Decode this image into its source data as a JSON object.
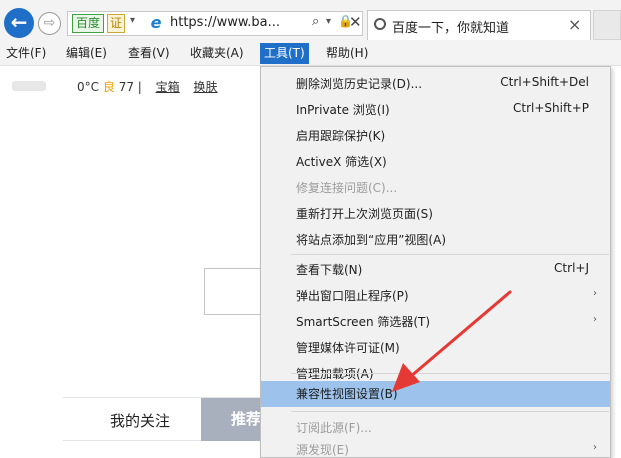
{
  "toolbar": {
    "back_icon": "back-arrow-icon",
    "forward_icon": "forward-arrow-icon",
    "site_label": "百度",
    "cert_label": "证",
    "url": "https://www.ba...",
    "search_glyph": "⌕",
    "lock_glyph": "🔒",
    "close_glyph": "✕",
    "dropdown_glyph": "▾",
    "back_glyph": "←",
    "forward_glyph": "⇨",
    "ie_glyph": "e"
  },
  "tab": {
    "title": "百度一下，你就知道",
    "close_glyph": "×"
  },
  "menubar": {
    "items": [
      {
        "label": "文件(F)"
      },
      {
        "label": "编辑(E)"
      },
      {
        "label": "查看(V)"
      },
      {
        "label": "收藏夹(A)"
      },
      {
        "label": "工具(T)"
      },
      {
        "label": "帮助(H)"
      }
    ]
  },
  "page": {
    "temperature": "0°C",
    "air_quality_label": "良",
    "aqi": "77",
    "separator": "|",
    "link1": "宝箱",
    "link2": "换肤",
    "feed_tab1": "我的关注",
    "feed_tab2": "推荐"
  },
  "tools_menu": {
    "items": [
      {
        "label": "删除浏览历史记录(D)...",
        "shortcut": "Ctrl+Shift+Del"
      },
      {
        "label": "InPrivate 浏览(I)",
        "shortcut": "Ctrl+Shift+P"
      },
      {
        "label": "启用跟踪保护(K)"
      },
      {
        "label": "ActiveX 筛选(X)"
      },
      {
        "label": "修复连接问题(C)..."
      },
      {
        "label": "重新打开上次浏览页面(S)"
      },
      {
        "label": "将站点添加到“应用”视图(A)"
      },
      {
        "label": "查看下载(N)",
        "shortcut": "Ctrl+J"
      },
      {
        "label": "弹出窗口阻止程序(P)",
        "arrow": "›"
      },
      {
        "label": "SmartScreen 筛选器(T)",
        "arrow": "›"
      },
      {
        "label": "管理媒体许可证(M)"
      },
      {
        "label": "管理加载项(A)"
      },
      {
        "label": "兼容性视图设置(B)"
      },
      {
        "label": "订阅此源(F)..."
      },
      {
        "label": "源发现(E)",
        "arrow": "›"
      }
    ]
  },
  "colors": {
    "accent": "#1f6fc9",
    "highlight": "#9dc3ec",
    "annotation": "#e53935"
  }
}
